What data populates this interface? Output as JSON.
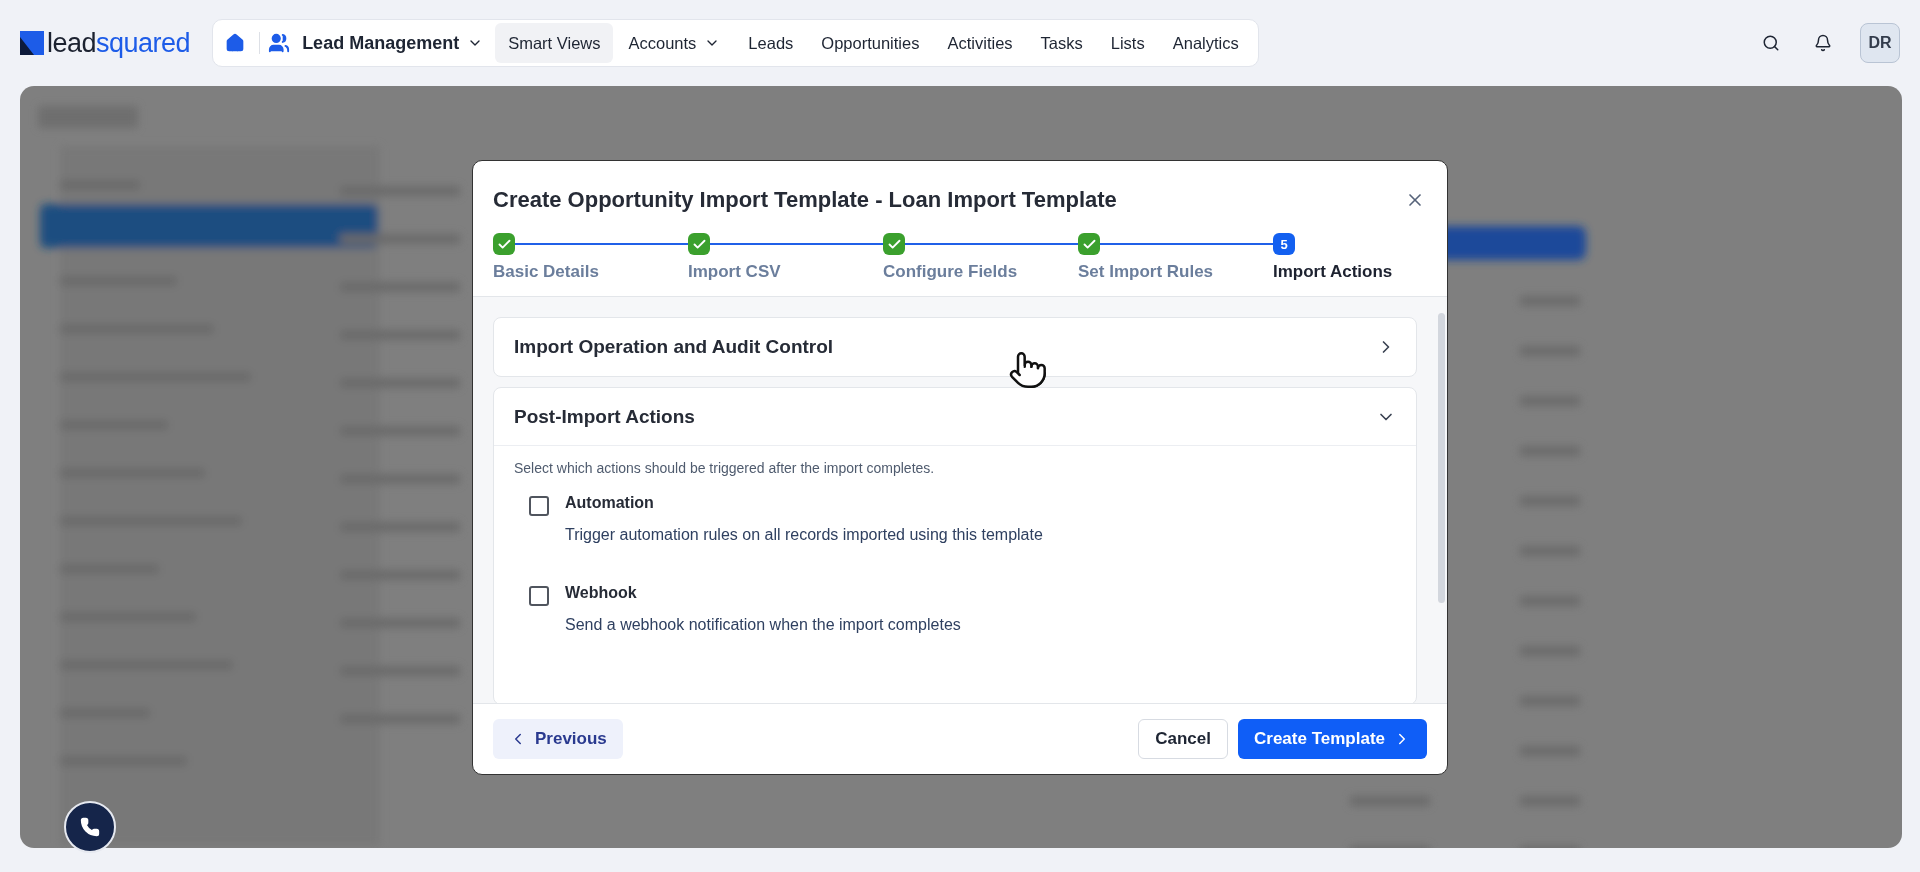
{
  "header": {
    "logo": {
      "part_1": "lead",
      "part_2": "squared"
    },
    "module": "Lead Management",
    "nav": [
      {
        "label": "Smart Views",
        "highlighted": true,
        "has_menu": false
      },
      {
        "label": "Accounts",
        "highlighted": false,
        "has_menu": true
      },
      {
        "label": "Leads",
        "highlighted": false,
        "has_menu": false
      },
      {
        "label": "Opportunities",
        "highlighted": false,
        "has_menu": false
      },
      {
        "label": "Activities",
        "highlighted": false,
        "has_menu": false
      },
      {
        "label": "Tasks",
        "highlighted": false,
        "has_menu": false
      },
      {
        "label": "Lists",
        "highlighted": false,
        "has_menu": false
      },
      {
        "label": "Analytics",
        "highlighted": false,
        "has_menu": false
      }
    ],
    "avatar": "DR"
  },
  "modal": {
    "title": "Create Opportunity Import Template - Loan Import Template",
    "steps": [
      {
        "label": "Basic Details",
        "done": true
      },
      {
        "label": "Import CSV",
        "done": true
      },
      {
        "label": "Configure Fields",
        "done": true
      },
      {
        "label": "Set Import Rules",
        "done": true
      },
      {
        "label": "Import Actions",
        "done": false,
        "number": "5"
      }
    ],
    "sections": [
      {
        "title": "Import Operation and Audit Control",
        "expanded": false
      },
      {
        "title": "Post-Import Actions",
        "expanded": true,
        "description": "Select which actions should be triggered after the import completes.",
        "options": [
          {
            "label": "Automation",
            "description": "Trigger automation rules on all records imported using this template",
            "checked": false
          },
          {
            "label": "Webhook",
            "description": "Send a webhook notification when the import completes",
            "checked": false
          }
        ]
      }
    ],
    "footer": {
      "previous": "Previous",
      "cancel": "Cancel",
      "create": "Create Template"
    }
  }
}
